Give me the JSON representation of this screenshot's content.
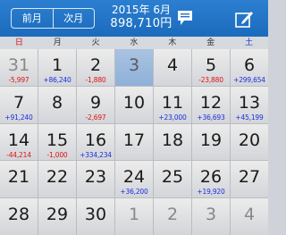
{
  "header": {
    "prev_label": "前月",
    "next_label": "次月",
    "month_label": "2015年 6月",
    "total": "898,710円"
  },
  "weekdays": [
    "日",
    "月",
    "火",
    "水",
    "木",
    "金",
    "土"
  ],
  "weeks": [
    [
      {
        "day": "31",
        "amount": "-5,997",
        "sign": "neg",
        "other": true
      },
      {
        "day": "1",
        "amount": "+86,240",
        "sign": "pos"
      },
      {
        "day": "2",
        "amount": "-1,880",
        "sign": "neg"
      },
      {
        "day": "3",
        "amount": "",
        "today": true
      },
      {
        "day": "4",
        "amount": ""
      },
      {
        "day": "5",
        "amount": "-23,880",
        "sign": "neg"
      },
      {
        "day": "6",
        "amount": "+299,654",
        "sign": "pos"
      }
    ],
    [
      {
        "day": "7",
        "amount": "+91,240",
        "sign": "pos"
      },
      {
        "day": "8",
        "amount": ""
      },
      {
        "day": "9",
        "amount": "-2,697",
        "sign": "neg"
      },
      {
        "day": "10",
        "amount": ""
      },
      {
        "day": "11",
        "amount": "+23,000",
        "sign": "pos"
      },
      {
        "day": "12",
        "amount": "+36,693",
        "sign": "pos"
      },
      {
        "day": "13",
        "amount": "+45,199",
        "sign": "pos"
      }
    ],
    [
      {
        "day": "14",
        "amount": "-44,214",
        "sign": "neg"
      },
      {
        "day": "15",
        "amount": "-1,000",
        "sign": "neg"
      },
      {
        "day": "16",
        "amount": "+334,234",
        "sign": "pos"
      },
      {
        "day": "17",
        "amount": ""
      },
      {
        "day": "18",
        "amount": ""
      },
      {
        "day": "19",
        "amount": ""
      },
      {
        "day": "20",
        "amount": ""
      }
    ],
    [
      {
        "day": "21",
        "amount": ""
      },
      {
        "day": "22",
        "amount": ""
      },
      {
        "day": "23",
        "amount": ""
      },
      {
        "day": "24",
        "amount": "+36,200",
        "sign": "pos"
      },
      {
        "day": "25",
        "amount": ""
      },
      {
        "day": "26",
        "amount": "+19,920",
        "sign": "pos"
      },
      {
        "day": "27",
        "amount": ""
      }
    ],
    [
      {
        "day": "28",
        "amount": ""
      },
      {
        "day": "29",
        "amount": ""
      },
      {
        "day": "30",
        "amount": ""
      },
      {
        "day": "1",
        "amount": "",
        "other": true
      },
      {
        "day": "2",
        "amount": "",
        "other": true
      },
      {
        "day": "3",
        "amount": "",
        "other": true
      },
      {
        "day": "4",
        "amount": "",
        "other": true
      }
    ]
  ],
  "icons": {
    "memo": "memo-speech-bubble-icon",
    "edit": "edit-pencil-icon"
  },
  "colors": {
    "header": "#1f72c4",
    "negative": "#e01212",
    "positive": "#1a2ee0",
    "today": "#a9c3e1"
  }
}
